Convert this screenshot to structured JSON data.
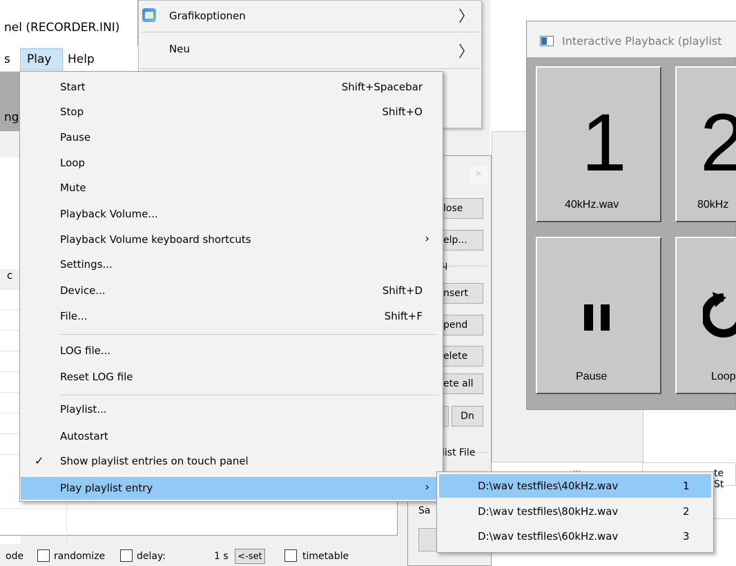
{
  "main_window": {
    "title_fragment": "nel  (RECORDER.INI)",
    "menubar": {
      "s": "s",
      "play": "Play",
      "help": "Help"
    },
    "toolbar_fragment": "ng",
    "list_fragment": "c"
  },
  "context_menu": {
    "items": [
      {
        "label": "Grafikoptionen",
        "arrow": "〉"
      },
      {
        "label": "Neu",
        "arrow": "〉"
      }
    ]
  },
  "playlist_dialog": {
    "buttons": [
      "lose",
      "elp...",
      "nsert",
      "pend",
      "elete",
      "ete all",
      "Dn"
    ],
    "group_fragment": "ɥ",
    "list_file_label": "list File",
    "save_fragment": "Sa"
  },
  "options_bar": {
    "mode_fragment": "ode",
    "randomize": "randomize",
    "delay": "delay:",
    "delay_value": "1 s",
    "set_button": "<-set",
    "timetable": "timetable"
  },
  "right_window": {
    "header_fragment": "te St",
    "dots": "..."
  },
  "interactive_playback": {
    "title": "Interactive Playback (playlist",
    "tiles": [
      {
        "number": "1",
        "label": "40kHz.wav"
      },
      {
        "number": "2",
        "label": "80kHz"
      },
      {
        "icon": "pause-icon",
        "label": "Pause"
      },
      {
        "icon": "loop-icon",
        "label": "Loop"
      }
    ]
  },
  "play_menu": {
    "items": [
      {
        "label": "Start",
        "shortcut": "Shift+Spacebar"
      },
      {
        "label": "Stop",
        "shortcut": "Shift+O"
      },
      {
        "label": "Pause"
      },
      {
        "label": "Loop"
      },
      {
        "label": "Mute"
      },
      {
        "label": "Playback Volume..."
      },
      {
        "label": "Playback Volume keyboard shortcuts",
        "arrow": "›"
      },
      {
        "label": "Settings..."
      },
      {
        "label": "Device...",
        "shortcut": "Shift+D"
      },
      {
        "label": "File...",
        "shortcut": "Shift+F"
      },
      {
        "label": "LOG file..."
      },
      {
        "label": "Reset LOG file"
      },
      {
        "label": "Playlist..."
      },
      {
        "label": "Autostart"
      },
      {
        "label": "Show playlist entries on touch panel",
        "checked": true,
        "check": "✓"
      },
      {
        "label": "Play playlist entry",
        "arrow": "›",
        "highlighted": true
      }
    ]
  },
  "playlist_submenu": {
    "items": [
      {
        "label": "D:\\wav testfiles\\40kHz.wav",
        "number": "1",
        "highlighted": true
      },
      {
        "label": "D:\\wav testfiles\\80kHz.wav",
        "number": "2"
      },
      {
        "label": "D:\\wav testfiles\\60kHz.wav",
        "number": "3"
      }
    ]
  },
  "colors": {
    "menu_highlight": "#91c9f7",
    "menubar_selected": "#cce4f7",
    "tile_face": "#c8c8c8",
    "panel_bg": "#ababab"
  }
}
